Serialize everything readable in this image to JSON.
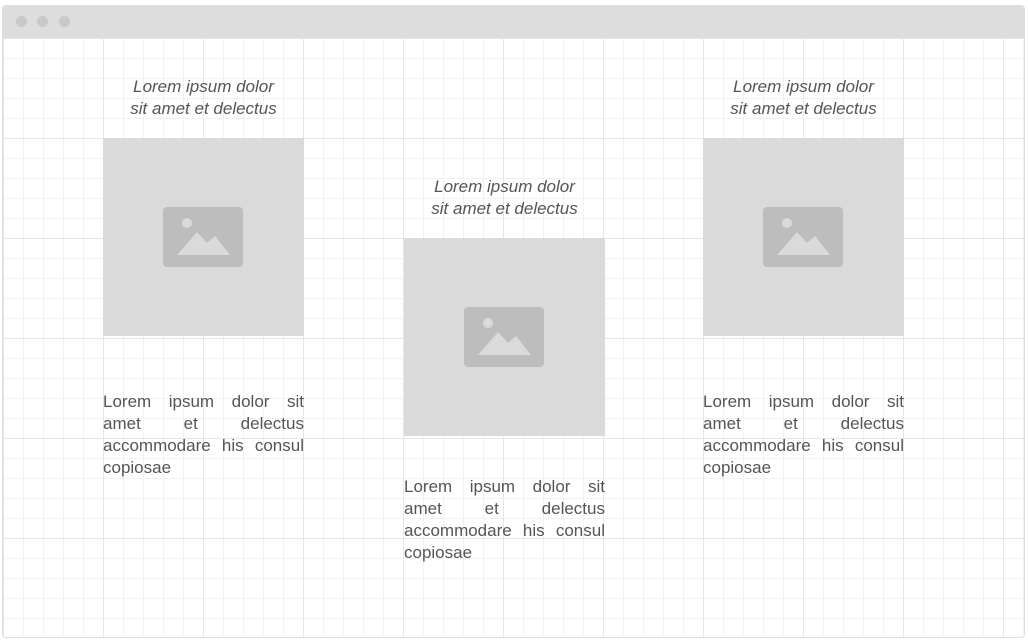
{
  "cards": [
    {
      "heading_line1": "Lorem ipsum dolor",
      "heading_line2": "sit amet et delectus",
      "image_icon": "image-placeholder-icon",
      "body": "Lorem ipsum dolor sit amet et delectus accommodare his consul copiosae"
    },
    {
      "heading_line1": "Lorem ipsum dolor",
      "heading_line2": "sit amet et delectus",
      "image_icon": "image-placeholder-icon",
      "body": "Lorem ipsum dolor sit amet et delectus accommodare his consul copiosae"
    },
    {
      "heading_line1": "Lorem ipsum dolor",
      "heading_line2": "sit amet et delectus",
      "image_icon": "image-placeholder-icon",
      "body": "Lorem ipsum dolor sit amet et delectus accommodare his consul copiosae"
    }
  ],
  "colors": {
    "titlebar": "#dddddd",
    "placeholder": "#dadada",
    "icon": "#bdbdbd",
    "text": "#555555"
  }
}
